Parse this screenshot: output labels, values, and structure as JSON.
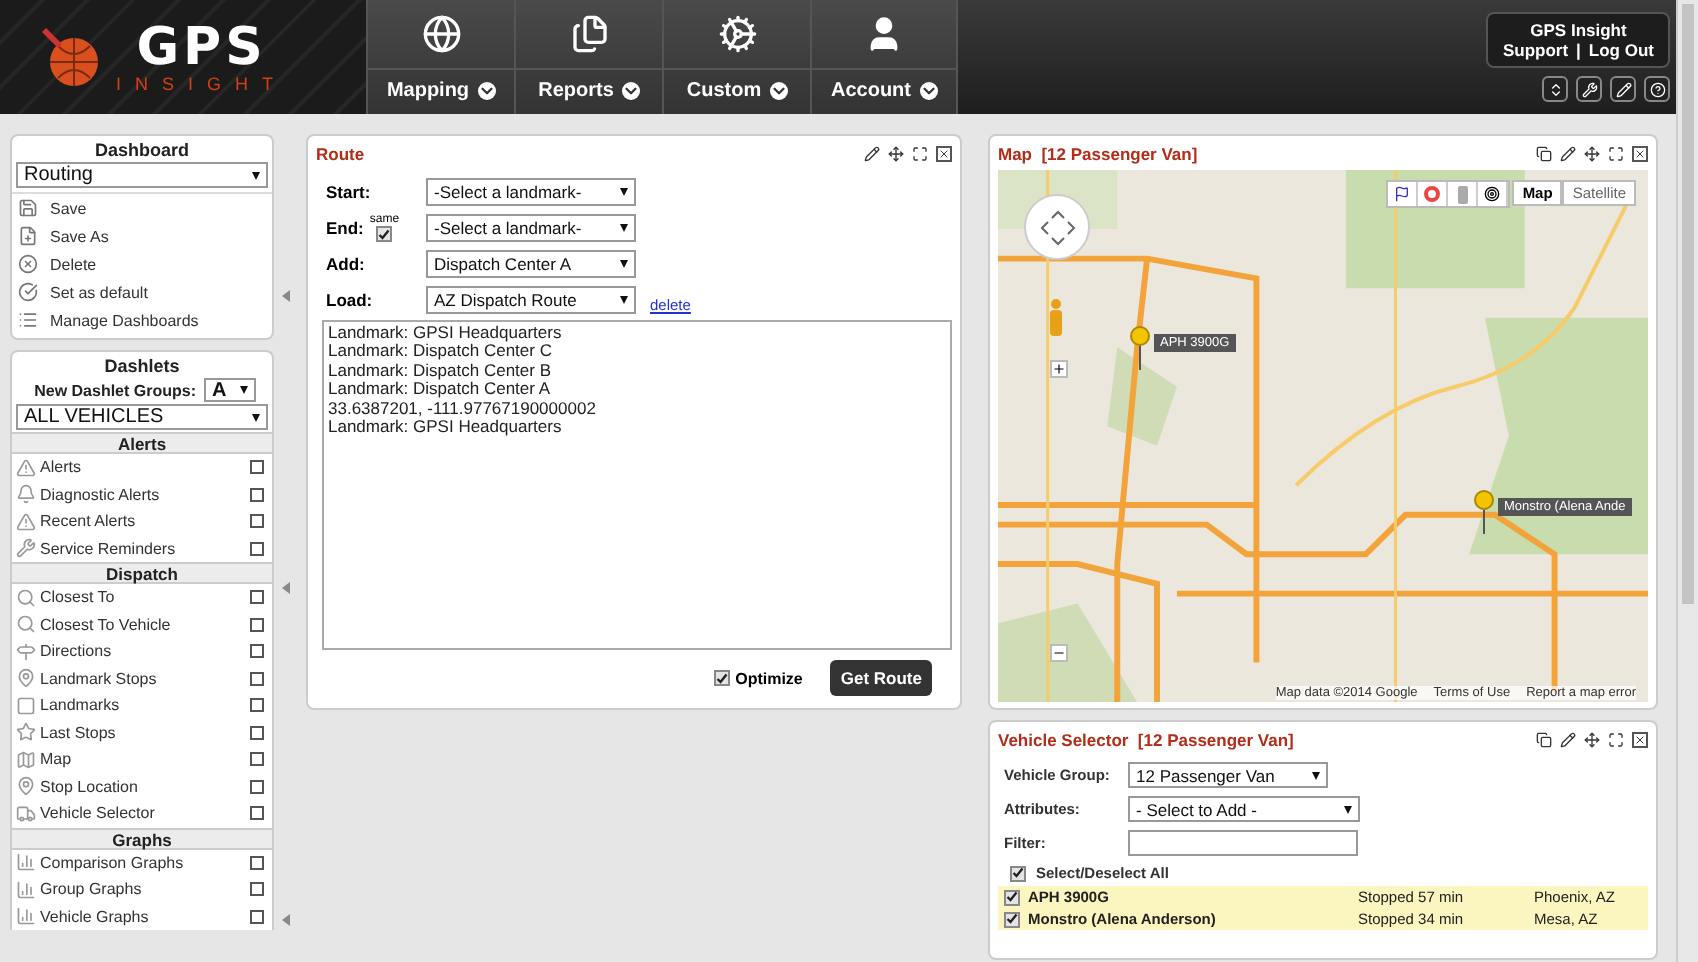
{
  "header": {
    "logo": {
      "title": "GPS",
      "subtitle": "INSIGHT"
    },
    "nav": [
      {
        "label": "Mapping",
        "kind": "globe"
      },
      {
        "label": "Reports",
        "kind": "docs"
      },
      {
        "label": "Custom",
        "kind": "gears"
      },
      {
        "label": "Account",
        "kind": "person"
      }
    ],
    "user": {
      "name": "GPS Insight",
      "links": [
        "Support",
        "Log Out"
      ],
      "separator": "|"
    }
  },
  "sidebar": {
    "dashboard": {
      "title": "Dashboard",
      "select": "Routing",
      "actions": [
        {
          "label": "Save",
          "kind": "save"
        },
        {
          "label": "Save As",
          "kind": "saveas"
        },
        {
          "label": "Delete",
          "kind": "delete"
        },
        {
          "label": "Set as default",
          "kind": "check"
        },
        {
          "label": "Manage Dashboards",
          "kind": "list"
        }
      ]
    },
    "dashlets": {
      "title": "Dashlets",
      "groups_label": "New Dashlet Groups:",
      "groups_value": "A",
      "vehicles": "ALL VEHICLES",
      "sections": [
        {
          "title": "Alerts",
          "items": [
            {
              "label": "Alerts"
            },
            {
              "label": "Diagnostic Alerts"
            },
            {
              "label": "Recent Alerts"
            },
            {
              "label": "Service Reminders"
            }
          ]
        },
        {
          "title": "Dispatch",
          "items": [
            {
              "label": "Closest To"
            },
            {
              "label": "Closest To Vehicle"
            },
            {
              "label": "Directions"
            },
            {
              "label": "Landmark Stops"
            },
            {
              "label": "Landmarks"
            },
            {
              "label": "Last Stops"
            },
            {
              "label": "Map"
            },
            {
              "label": "Stop Location"
            },
            {
              "label": "Vehicle Selector"
            }
          ]
        },
        {
          "title": "Graphs",
          "items": [
            {
              "label": "Comparison Graphs"
            },
            {
              "label": "Group Graphs"
            },
            {
              "label": "Vehicle Graphs"
            }
          ]
        }
      ]
    }
  },
  "route": {
    "title": "Route",
    "fields": [
      {
        "label": "Start:",
        "value": "-Select a landmark-"
      },
      {
        "label": "End:",
        "value": "-Select a landmark-"
      },
      {
        "label": "Add:",
        "value": "Dispatch Center A"
      },
      {
        "label": "Load:",
        "value": "AZ Dispatch Route"
      }
    ],
    "same": {
      "label": "same",
      "checked": true
    },
    "delete": "delete",
    "stops": [
      "Landmark: GPSI Headquarters",
      "Landmark: Dispatch Center C",
      "Landmark: Dispatch Center B",
      "Landmark: Dispatch Center A",
      "33.6387201, -111.97767190000002",
      "Landmark: GPSI Headquarters"
    ],
    "optimize": {
      "label": "Optimize",
      "checked": true
    },
    "button": "Get Route"
  },
  "map": {
    "title": "Map",
    "subtitle": "[12 Passenger Van]",
    "map_types": [
      {
        "label": "Map",
        "selected": true
      },
      {
        "label": "Satellite",
        "selected": false
      }
    ],
    "markers": [
      {
        "label": "APH 3900G"
      },
      {
        "label": "Monstro (Alena Ande"
      }
    ],
    "attribution": [
      "Map data ©2014 Google",
      "Terms of Use",
      "Report a map error"
    ]
  },
  "vehicle_selector": {
    "title": "Vehicle Selector",
    "subtitle": "[12 Passenger Van]",
    "group_label": "Vehicle Group:",
    "group_value": "12 Passenger Van",
    "attributes_label": "Attributes:",
    "attributes_value": "- Select to Add -",
    "filter_label": "Filter:",
    "select_all": {
      "label": "Select/Deselect All",
      "checked": true
    },
    "vehicles": [
      {
        "name": "APH 3900G",
        "status": "Stopped 57 min",
        "location": "Phoenix, AZ",
        "checked": true
      },
      {
        "name": "Monstro (Alena Anderson)",
        "status": "Stopped 34 min",
        "location": "Mesa, AZ",
        "checked": true
      }
    ]
  }
}
